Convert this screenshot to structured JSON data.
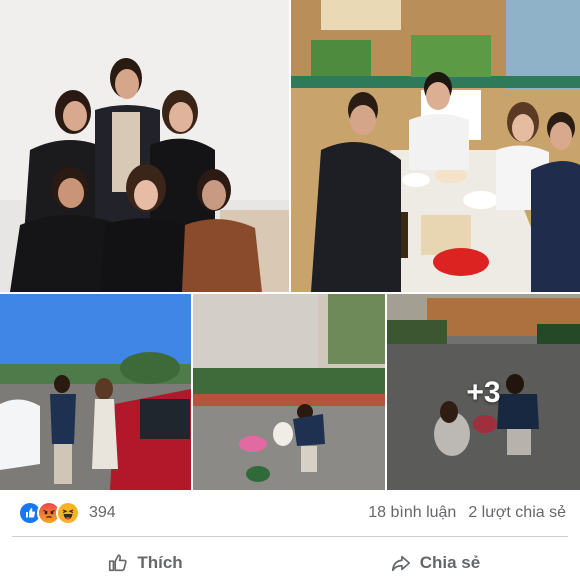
{
  "photos": {
    "more_count": "+3"
  },
  "reactions": {
    "types": [
      "like-icon",
      "angry-icon",
      "haha-icon"
    ],
    "colors": {
      "like": "#1877f2",
      "angry": "#e9710f",
      "haha": "#f7b125"
    },
    "count": "394"
  },
  "stats": {
    "comments": "18 bình luận",
    "shares": "2 lượt chia sẻ"
  },
  "actions": {
    "like_label": "Thích",
    "share_label": "Chia sẻ"
  }
}
